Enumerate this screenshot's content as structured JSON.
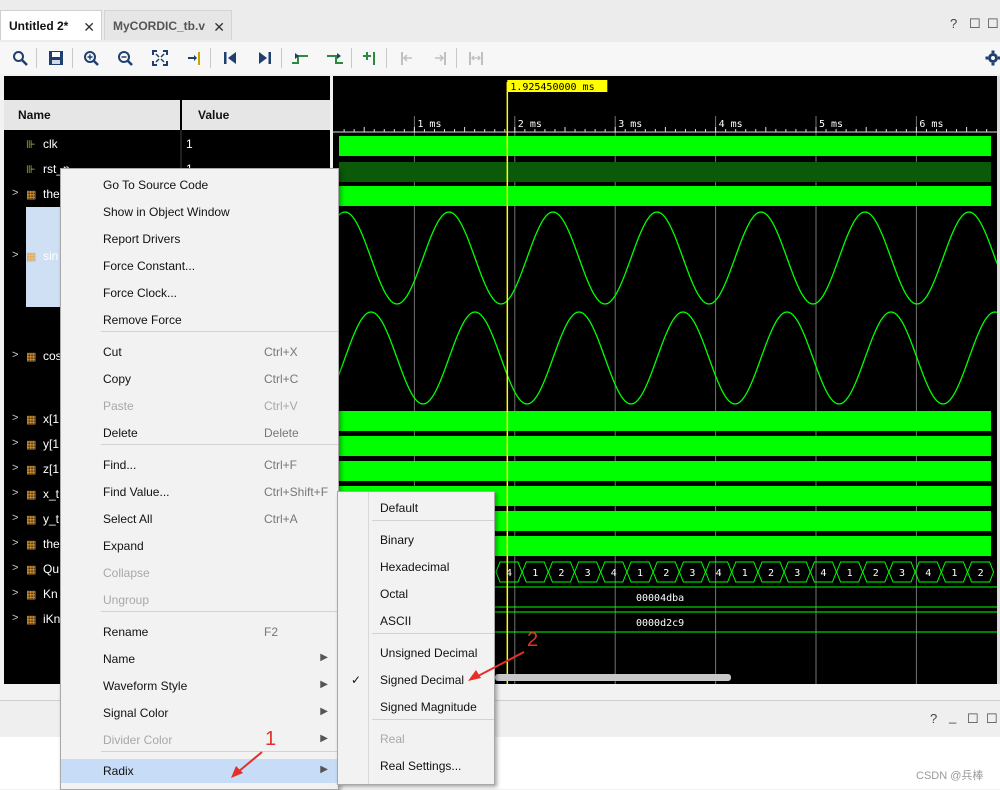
{
  "tabs": [
    {
      "label": "Untitled 2*",
      "active": true
    },
    {
      "label": "MyCORDIC_tb.v",
      "active": false
    }
  ],
  "window_controls": [
    "?",
    "□",
    "□"
  ],
  "toolbar_icons": [
    "search-icon",
    "save-icon",
    "zoom-in-icon",
    "zoom-out-icon",
    "zoom-fit-icon",
    "go-to-cursor-icon",
    "go-to-time-zero-icon",
    "go-to-last-time-icon",
    "previous-transition-icon",
    "next-transition-icon",
    "add-marker-icon",
    "previous-marker-icon",
    "next-marker-icon",
    "swap-cursors-icon",
    "settings-icon"
  ],
  "columns": {
    "name": "Name",
    "value": "Value"
  },
  "signals": [
    {
      "name": "clk",
      "value": "1",
      "expand": ""
    },
    {
      "name": "rst_n",
      "value": "1",
      "expand": ""
    },
    {
      "name": "the",
      "value": "",
      "expand": ">"
    },
    {
      "name": "sin",
      "value": "",
      "expand": ">"
    },
    {
      "name": "cos",
      "value": "",
      "expand": ">"
    },
    {
      "name": "x[1",
      "value": "",
      "expand": ">"
    },
    {
      "name": "y[1",
      "value": "",
      "expand": ">"
    },
    {
      "name": "z[1",
      "value": "",
      "expand": ">"
    },
    {
      "name": "x_t",
      "value": "",
      "expand": ">"
    },
    {
      "name": "y_t",
      "value": "",
      "expand": ">"
    },
    {
      "name": "the",
      "value": "",
      "expand": ">"
    },
    {
      "name": "Qu",
      "value": "",
      "expand": ">"
    },
    {
      "name": "Kn",
      "value": "",
      "expand": ">"
    },
    {
      "name": "iKn",
      "value": "",
      "expand": ">"
    }
  ],
  "cursor_time": "1.925450000 ms",
  "time_ticks": [
    "1 ms",
    "2 ms",
    "3 ms",
    "4 ms",
    "5 ms",
    "6 ms"
  ],
  "bus_values": {
    "quadrant": [
      "4",
      "1",
      "2",
      "3",
      "4",
      "1",
      "2",
      "3",
      "4",
      "1",
      "2",
      "3",
      "4",
      "1",
      "2",
      "3",
      "4",
      "1",
      "2"
    ],
    "kn": "00004dba",
    "ikn": "0000d2c9"
  },
  "context_menu": [
    {
      "label": "Go To Source Code",
      "shortcut": ""
    },
    {
      "label": "Show in Object Window",
      "shortcut": ""
    },
    {
      "label": "Report Drivers",
      "shortcut": ""
    },
    {
      "label": "Force Constant...",
      "shortcut": ""
    },
    {
      "label": "Force Clock...",
      "shortcut": ""
    },
    {
      "label": "Remove Force",
      "shortcut": ""
    },
    {
      "label": "Cut",
      "shortcut": "Ctrl+X"
    },
    {
      "label": "Copy",
      "shortcut": "Ctrl+C"
    },
    {
      "label": "Paste",
      "shortcut": "Ctrl+V",
      "disabled": true
    },
    {
      "label": "Delete",
      "shortcut": "Delete"
    },
    {
      "label": "Find...",
      "shortcut": "Ctrl+F"
    },
    {
      "label": "Find Value...",
      "shortcut": "Ctrl+Shift+F"
    },
    {
      "label": "Select All",
      "shortcut": "Ctrl+A"
    },
    {
      "label": "Expand",
      "shortcut": ""
    },
    {
      "label": "Collapse",
      "shortcut": "",
      "disabled": true
    },
    {
      "label": "Ungroup",
      "shortcut": "",
      "disabled": true
    },
    {
      "label": "Rename",
      "shortcut": "F2"
    },
    {
      "label": "Name",
      "submenu": true
    },
    {
      "label": "Waveform Style",
      "submenu": true
    },
    {
      "label": "Signal Color",
      "submenu": true
    },
    {
      "label": "Divider Color",
      "submenu": true,
      "disabled": true
    },
    {
      "label": "Radix",
      "submenu": true,
      "highlighted": true
    }
  ],
  "radix_menu": [
    {
      "label": "Default"
    },
    {
      "label": "Binary"
    },
    {
      "label": "Hexadecimal"
    },
    {
      "label": "Octal"
    },
    {
      "label": "ASCII"
    },
    {
      "label": "Unsigned Decimal"
    },
    {
      "label": "Signed Decimal",
      "checked": true
    },
    {
      "label": "Signed Magnitude"
    },
    {
      "label": "Real",
      "disabled": true
    },
    {
      "label": "Real Settings..."
    }
  ],
  "annotations": [
    "1",
    "2"
  ],
  "watermark": "CSDN @兵棒",
  "colors": {
    "wave": "#00ff00",
    "cursor": "#ffff00",
    "menu_highlight": "#c6dcf7",
    "annotation": "#e5302a"
  }
}
